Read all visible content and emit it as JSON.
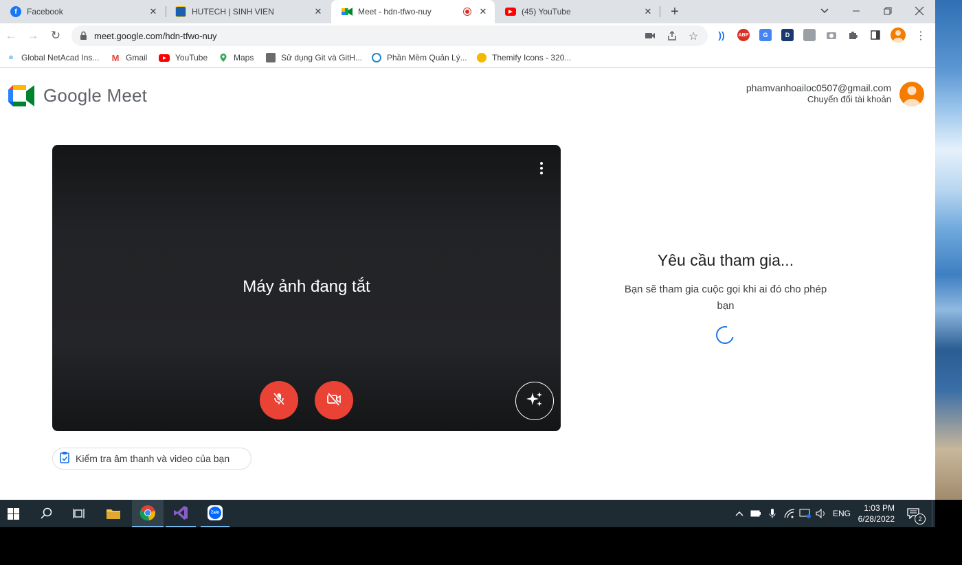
{
  "browser": {
    "tabs": [
      {
        "title": "Facebook",
        "icon": "facebook-icon",
        "color": "#1877f2"
      },
      {
        "title": "HUTECH | SINH VIEN",
        "icon": "hutech-shield-icon",
        "color": "#1a5fb4"
      },
      {
        "title": "Meet - hdn-tfwo-nuy",
        "icon": "google-meet-icon",
        "color": "#00832d",
        "active": true,
        "recording": true
      },
      {
        "title": "(45) YouTube",
        "icon": "youtube-icon",
        "color": "#ff0000"
      }
    ],
    "url": "meet.google.com/hdn-tfwo-nuy",
    "bookmarks": [
      {
        "label": "Global NetAcad Ins...",
        "icon": "cisco-icon"
      },
      {
        "label": "Gmail",
        "icon": "gmail-icon"
      },
      {
        "label": "YouTube",
        "icon": "youtube-icon"
      },
      {
        "label": "Maps",
        "icon": "maps-pin-icon"
      },
      {
        "label": "Sử dụng Git và GitH...",
        "icon": "bookmark-thumb-icon"
      },
      {
        "label": "Phần Mềm Quản Lý...",
        "icon": "bookmark-globe-icon"
      },
      {
        "label": "Themify Icons - 320...",
        "icon": "emoji-icon"
      }
    ],
    "extensions": [
      {
        "name": "wave-extension-icon",
        "label": ""
      },
      {
        "name": "adblock-plus-icon",
        "label": "ABP"
      },
      {
        "name": "google-translate-icon",
        "label": "G"
      },
      {
        "name": "dashlane-icon",
        "label": "D"
      },
      {
        "name": "photo-extension-icon",
        "label": ""
      },
      {
        "name": "camera-extension-icon",
        "label": ""
      },
      {
        "name": "puzzle-extensions-icon",
        "label": ""
      },
      {
        "name": "side-panel-icon",
        "label": ""
      }
    ]
  },
  "meet": {
    "logo_text": "Google Meet",
    "account_email": "phamvanhoailoc0507@gmail.com",
    "switch_account": "Chuyển đổi tài khoản",
    "camera_off_text": "Máy ảnh đang tắt",
    "check_av_label": "Kiểm tra âm thanh và video của bạn",
    "request_title": "Yêu cầu tham gia...",
    "request_subtitle": "Bạn sẽ tham gia cuộc gọi khi ai đó cho phép bạn"
  },
  "taskbar": {
    "language": "ENG",
    "time": "1:03 PM",
    "date": "6/28/2022",
    "notifications": "2",
    "zalo_label": "Zalo"
  },
  "colors": {
    "accent_blue": "#1a73e8",
    "mute_red": "#ea4335",
    "taskbar_bg": "#1f2b33"
  }
}
